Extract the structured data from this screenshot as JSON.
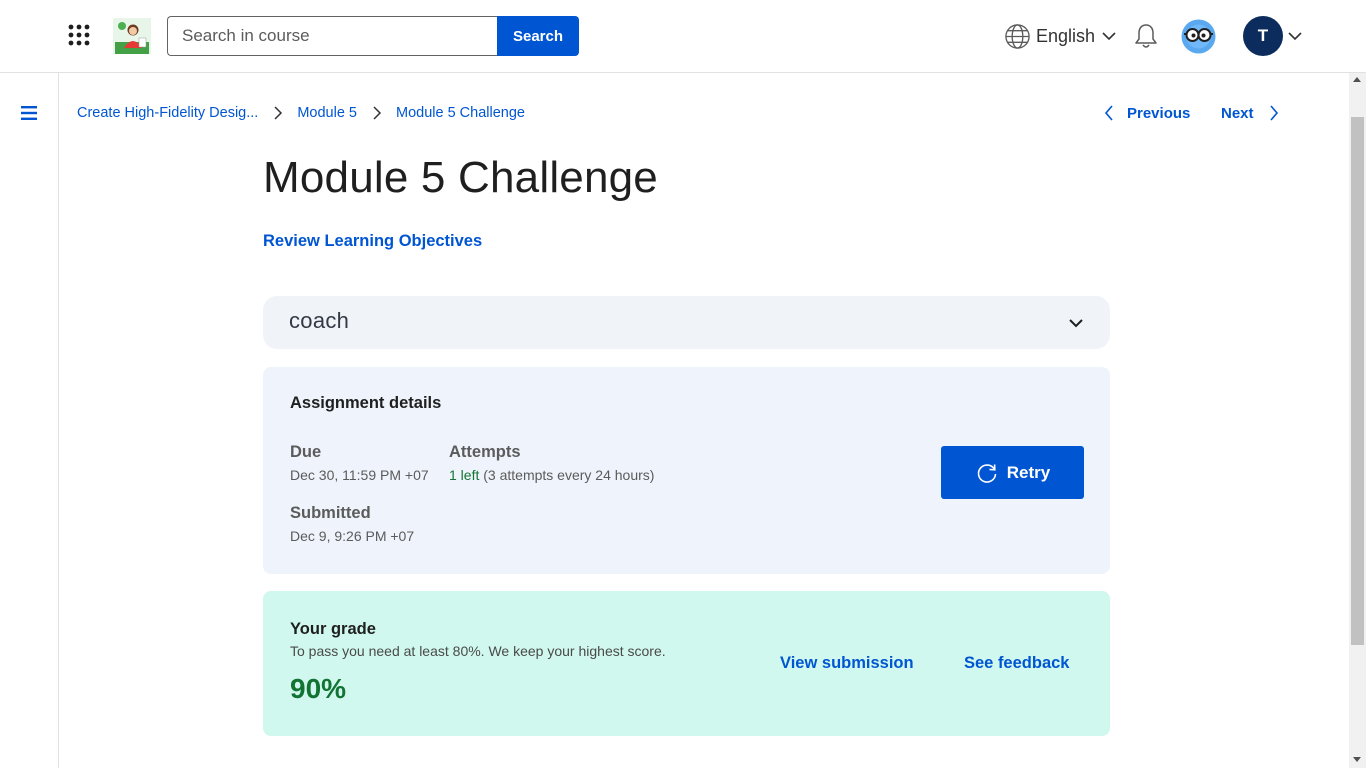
{
  "header": {
    "apps_icon": "apps-grid-icon",
    "course_logo": "course-thumbnail",
    "search": {
      "placeholder": "Search in course",
      "button_label": "Search"
    },
    "language": {
      "label": "English",
      "icon": "globe-icon"
    },
    "notifications_icon": "bell-icon",
    "coach_avatar_icon": "coach-avatar-icon",
    "user": {
      "initial": "T"
    }
  },
  "sidebar": {
    "menu_icon": "hamburger-icon"
  },
  "breadcrumb": {
    "items": [
      "Create High-Fidelity Desig...",
      "Module 5",
      "Module 5 Challenge"
    ]
  },
  "pager": {
    "previous": "Previous",
    "next": "Next"
  },
  "main": {
    "title": "Module 5 Challenge",
    "review_link": "Review Learning Objectives",
    "coach": {
      "label": "coach"
    },
    "assignment": {
      "heading": "Assignment details",
      "due_label": "Due",
      "due_value": "Dec 30, 11:59 PM +07",
      "attempts_label": "Attempts",
      "attempts_left": "1 left",
      "attempts_note": "(3 attempts every 24 hours)",
      "submitted_label": "Submitted",
      "submitted_value": "Dec 9, 9:26 PM +07",
      "retry_label": "Retry"
    },
    "grade": {
      "heading": "Your grade",
      "subtitle": "To pass you need at least 80%. We keep your highest score.",
      "value": "90%",
      "view_submission": "View submission",
      "see_feedback": "See feedback"
    }
  },
  "colors": {
    "primary": "#0056d2",
    "success": "#137333",
    "assignment_bg": "#eff4fc",
    "grade_bg": "#d0f8ee",
    "avatar_bg": "#0b2c5c"
  }
}
